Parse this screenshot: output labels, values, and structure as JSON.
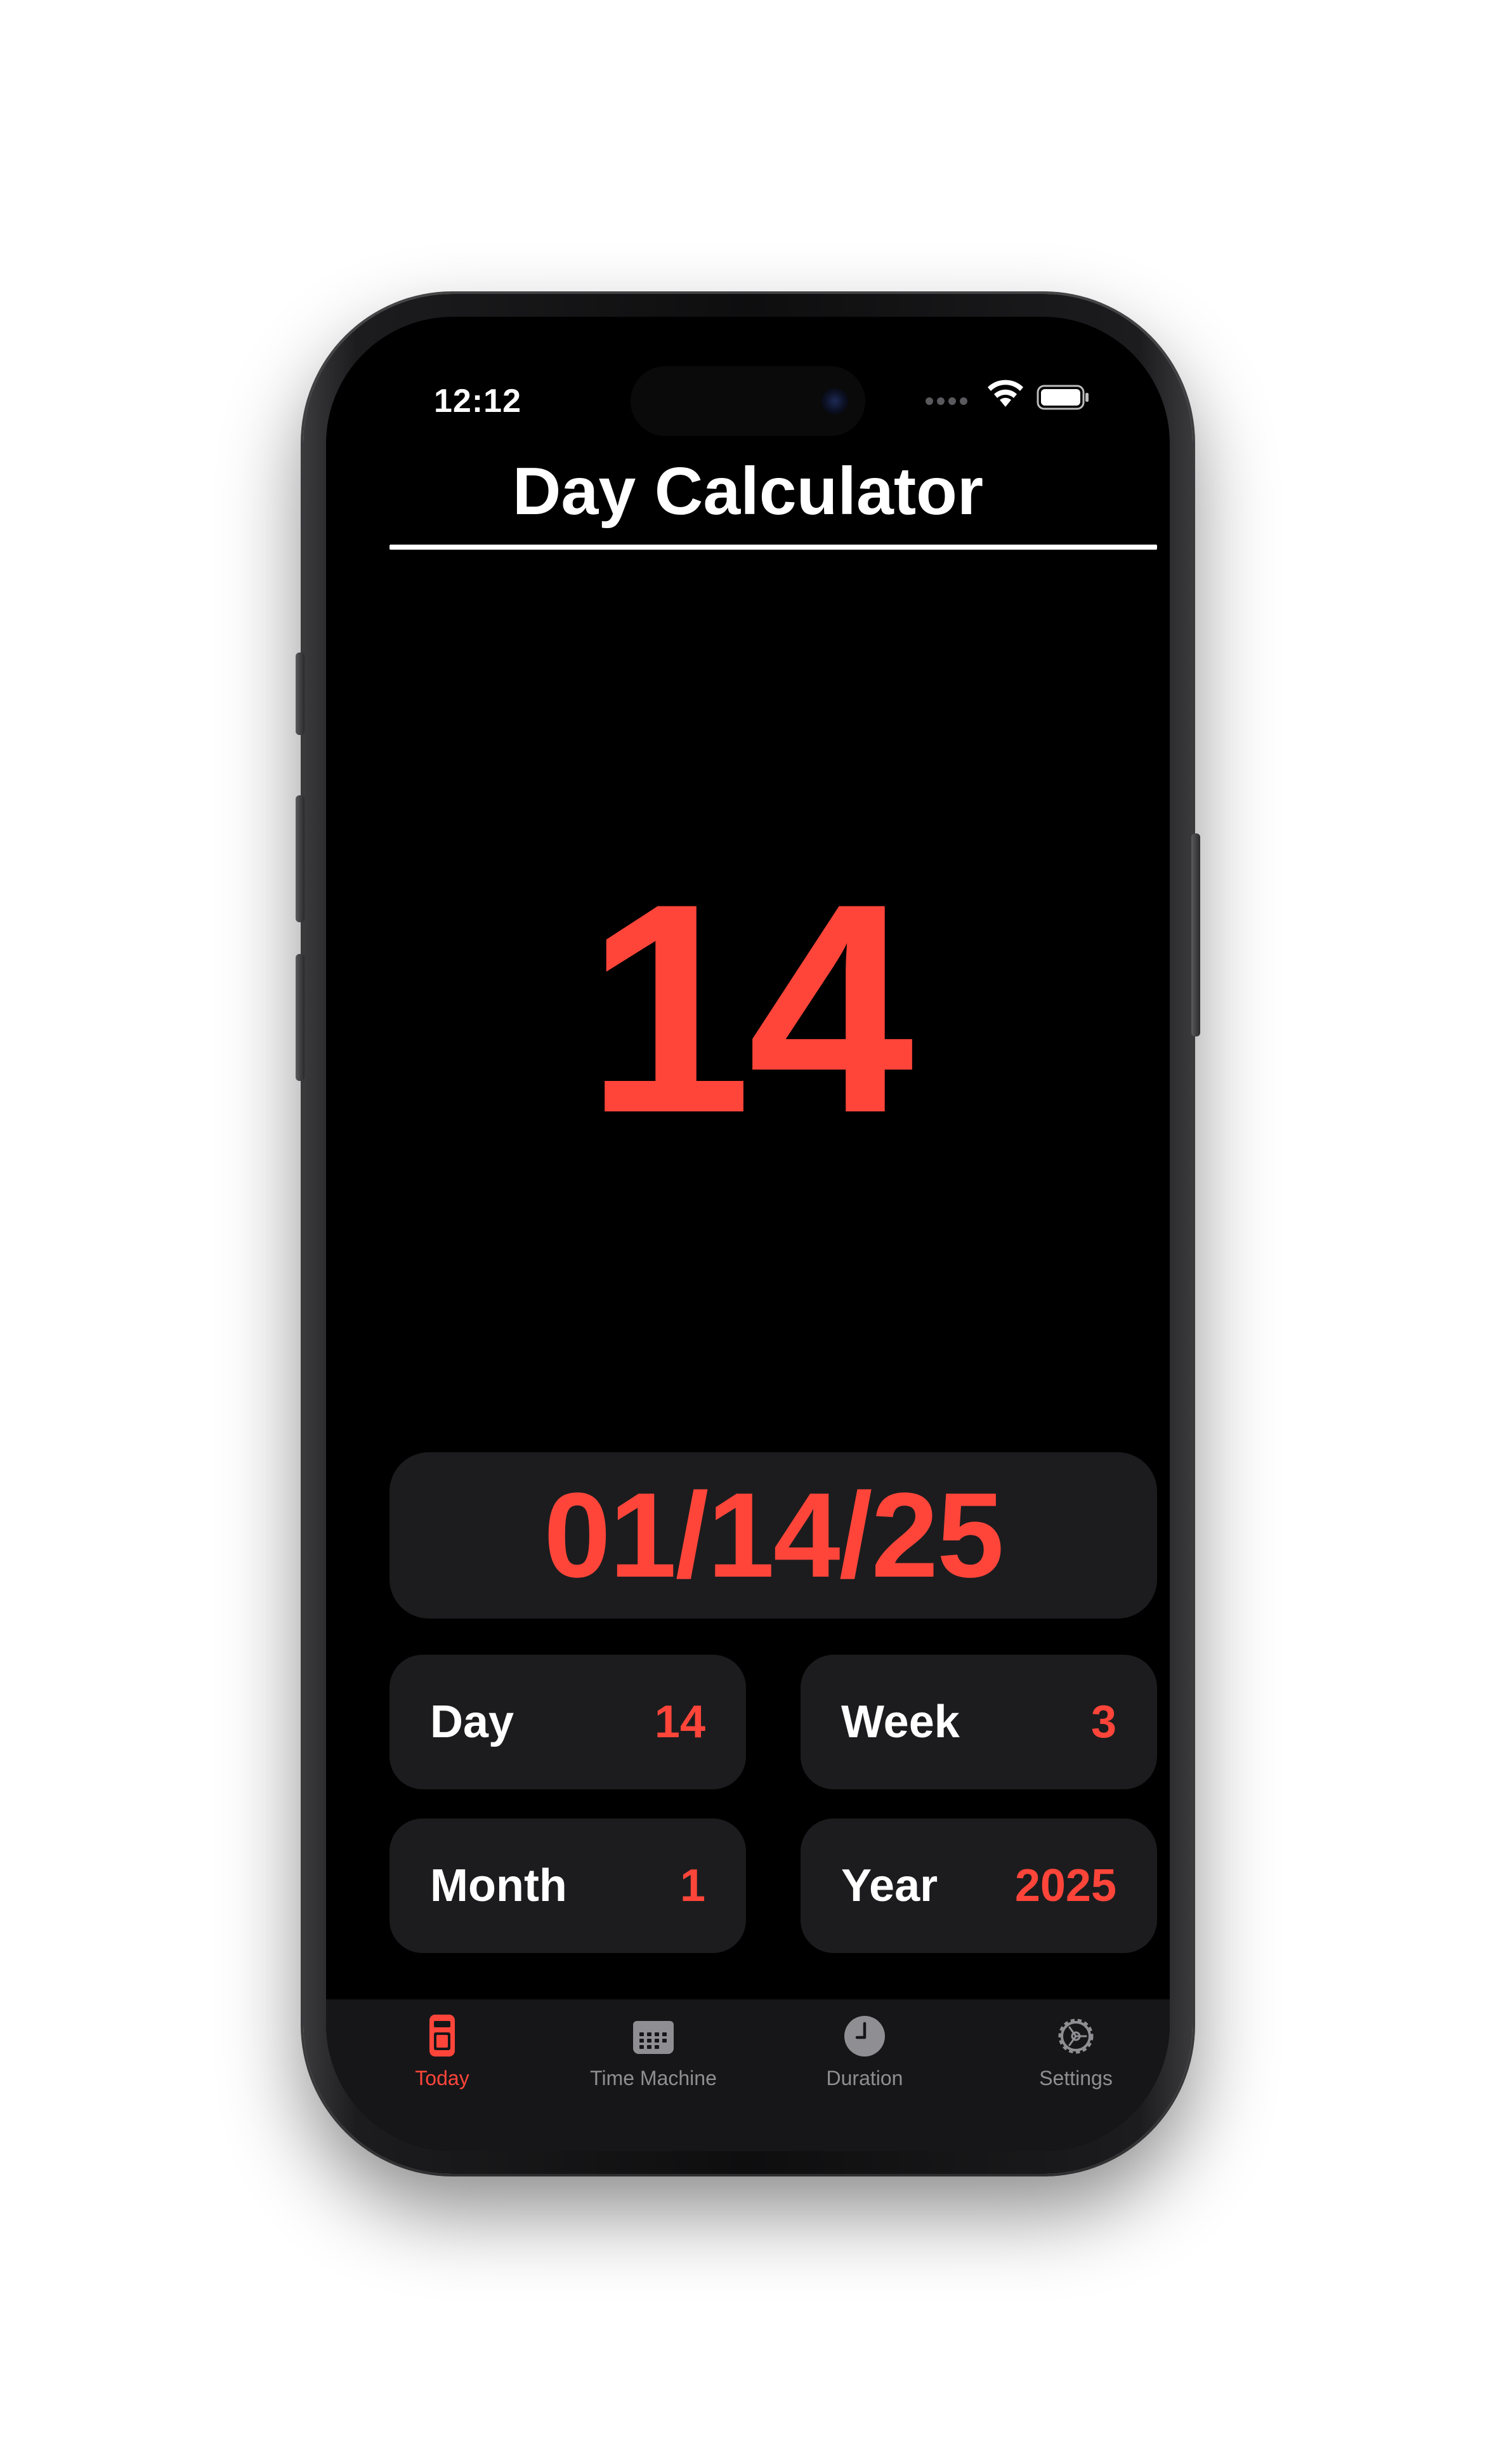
{
  "status_bar": {
    "time": "12:12"
  },
  "header": {
    "title": "Day Calculator"
  },
  "main": {
    "big_day": "14",
    "date": "01/14/25",
    "stats": [
      {
        "label": "Day",
        "value": "14"
      },
      {
        "label": "Week",
        "value": "3"
      },
      {
        "label": "Month",
        "value": "1"
      },
      {
        "label": "Year",
        "value": "2025"
      }
    ]
  },
  "tab_bar": {
    "tabs": [
      {
        "label": "Today",
        "icon": "today-icon",
        "active": true
      },
      {
        "label": "Time Machine",
        "icon": "calendar-icon",
        "active": false
      },
      {
        "label": "Duration",
        "icon": "clock-icon",
        "active": false
      },
      {
        "label": "Settings",
        "icon": "gear-icon",
        "active": false
      }
    ]
  },
  "colors": {
    "accent": "#ff453a",
    "background": "#000000",
    "card": "#1c1c1e",
    "inactive": "#8e8e93"
  }
}
